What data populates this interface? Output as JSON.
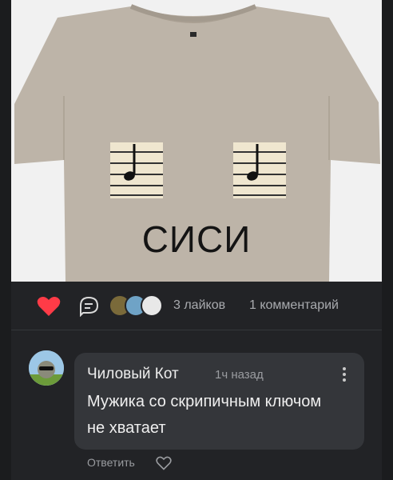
{
  "post": {
    "image_alt": "Футболка с нотами",
    "print_text": "СИСИ"
  },
  "actions": {
    "likes_text": "3 лайков",
    "comments_text": "1 комментарий",
    "liked": true,
    "accent_color": "#ff3b47"
  },
  "comment": {
    "author": "Чиловый Кот",
    "time": "1ч назад",
    "text": "Мужика со скрипичным ключом не хватает",
    "reply_label": "Ответить"
  }
}
